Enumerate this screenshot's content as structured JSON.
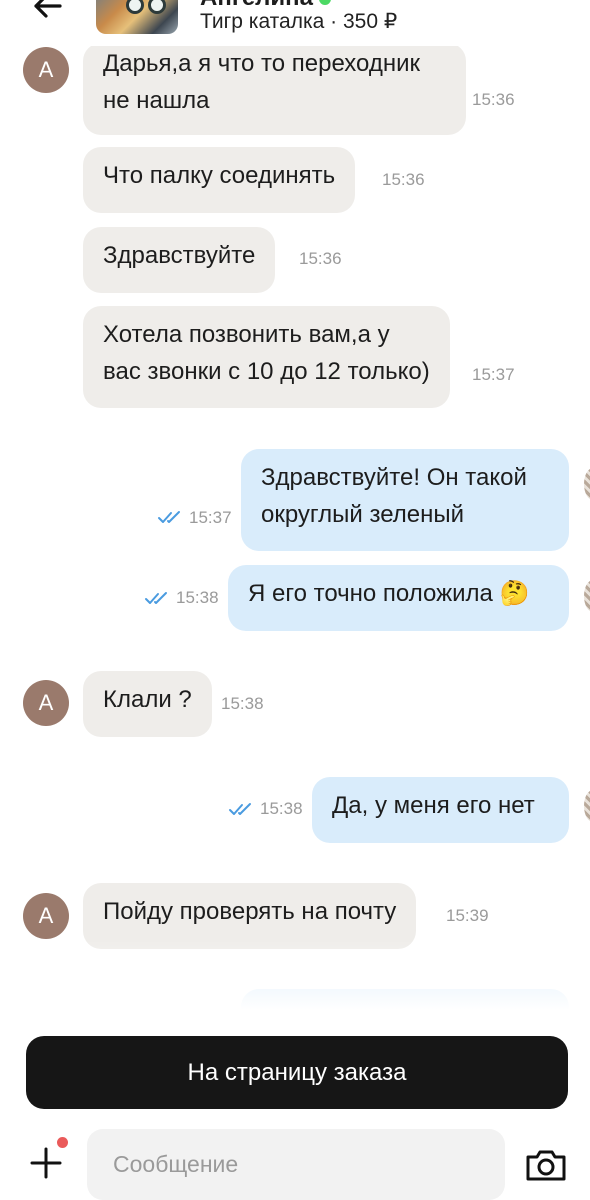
{
  "header": {
    "name": "Ангелина",
    "product": "Тигр каталка · 350 ₽"
  },
  "messages": [
    {
      "dir": "in",
      "text_lines": [
        "Дарья,а я что то переходник",
        "не нашла"
      ],
      "time": "15:36",
      "avatar": "А"
    },
    {
      "dir": "in",
      "text_lines": [
        "Что палку соединять"
      ],
      "time": "15:36"
    },
    {
      "dir": "in",
      "text_lines": [
        "Здравствуйте"
      ],
      "time": "15:36"
    },
    {
      "dir": "in",
      "text_lines": [
        "Хотела позвонить вам,а у",
        "вас звонки с 10 до 12 только)"
      ],
      "time": "15:37"
    },
    {
      "dir": "out",
      "text_lines": [
        "Здравствуйте! Он такой",
        "округлый зеленый"
      ],
      "time": "15:37",
      "read": true
    },
    {
      "dir": "out",
      "text_lines": [
        "Я его точно положила 🤔"
      ],
      "time": "15:38",
      "read": true
    },
    {
      "dir": "in",
      "text_lines": [
        "Клали ?"
      ],
      "time": "15:38",
      "avatar": "А"
    },
    {
      "dir": "out",
      "text_lines": [
        "Да, у меня его нет"
      ],
      "time": "15:38",
      "read": true
    },
    {
      "dir": "in",
      "text_lines": [
        "Пойду проверять на почту"
      ],
      "time": "15:39",
      "avatar": "А"
    }
  ],
  "bottom": {
    "order_button": "На страницу заказа",
    "message_placeholder": "Сообщение"
  },
  "icons": {
    "back": "arrow-left-icon",
    "add": "plus-icon",
    "camera": "camera-icon",
    "read": "double-check-icon"
  },
  "colors": {
    "incoming_bubble": "#efedea",
    "outgoing_bubble": "#d9ecfb",
    "read_ticks": "#4a9be0",
    "avatar": "#9a7a6c",
    "order_button": "#161616",
    "notification_dot": "#ea5a5a"
  }
}
